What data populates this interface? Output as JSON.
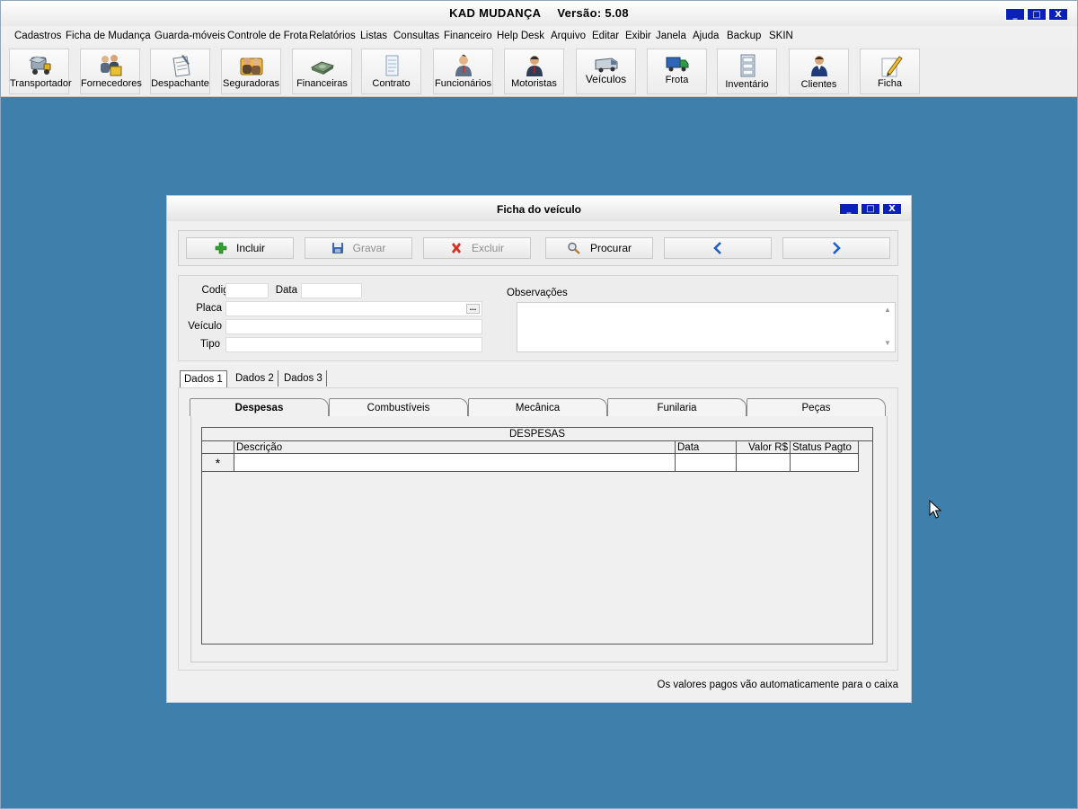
{
  "app": {
    "title": "KAD MUDANÇA",
    "version": "Versão: 5.08",
    "controls": [
      "_",
      "□",
      "X"
    ]
  },
  "menu": [
    "Cadastros",
    "Ficha de Mudança",
    "Guarda-móveis",
    "Controle de Frota",
    "Relatórios",
    "Listas",
    "Consultas",
    "Financeiro",
    "Help Desk",
    "Arquivo",
    "Editar",
    "Exibir",
    "Janela",
    "Ajuda",
    "Backup",
    "SKIN"
  ],
  "toolbar": [
    {
      "label": "Transportador",
      "icon": "truck-icon"
    },
    {
      "label": "Fornecedores",
      "icon": "suppliers-icon"
    },
    {
      "label": "Despachante",
      "icon": "clipboard-icon"
    },
    {
      "label": "Seguradoras",
      "icon": "insurance-icon"
    },
    {
      "label": "Financeiras",
      "icon": "money-icon"
    },
    {
      "label": "Contrato",
      "icon": "document-icon"
    },
    {
      "label": "Funcionários",
      "icon": "employee-icon"
    },
    {
      "label": "Motoristas",
      "icon": "driver-icon"
    },
    {
      "label": "Veículos",
      "icon": "van-icon"
    },
    {
      "label": "Frota",
      "icon": "fleet-truck-icon"
    },
    {
      "label": "Inventário",
      "icon": "cabinet-icon"
    },
    {
      "label": "Clientes",
      "icon": "client-icon"
    },
    {
      "label": "Ficha",
      "icon": "pencil-icon"
    }
  ],
  "dialog": {
    "title": "Ficha do veículo",
    "actions": {
      "incluir": "Incluir",
      "gravar": "Gravar",
      "excluir": "Excluir",
      "procurar": "Procurar",
      "prev": "‹",
      "next": "›"
    },
    "fields": {
      "codigo_label": "Codigo",
      "data_label": "Data",
      "placa_label": "Placa",
      "veiculo_label": "Veículo",
      "tipo_label": "Tipo",
      "observacoes_label": "Observações",
      "dots": "..."
    },
    "outer_tabs": [
      "Dados 1",
      "Dados 2",
      "Dados 3"
    ],
    "inner_tabs": [
      "Despesas",
      "Combustíveis",
      "Mecânica",
      "Funilaria",
      "Peças"
    ],
    "grid": {
      "caption": "DESPESAS",
      "columns": [
        "Descrição",
        "Data",
        "Valor R$",
        "Status Pagto"
      ],
      "new_row_marker": "*"
    },
    "footer_note": "Os valores pagos vão automaticamente para o caixa"
  },
  "colors": {
    "workspace": "#3e7fab",
    "title_buttons": "#0a20b8",
    "incluir_icon": "#2fa12f",
    "excluir_icon": "#d82f1f",
    "nav_arrow": "#1f5fc8"
  }
}
